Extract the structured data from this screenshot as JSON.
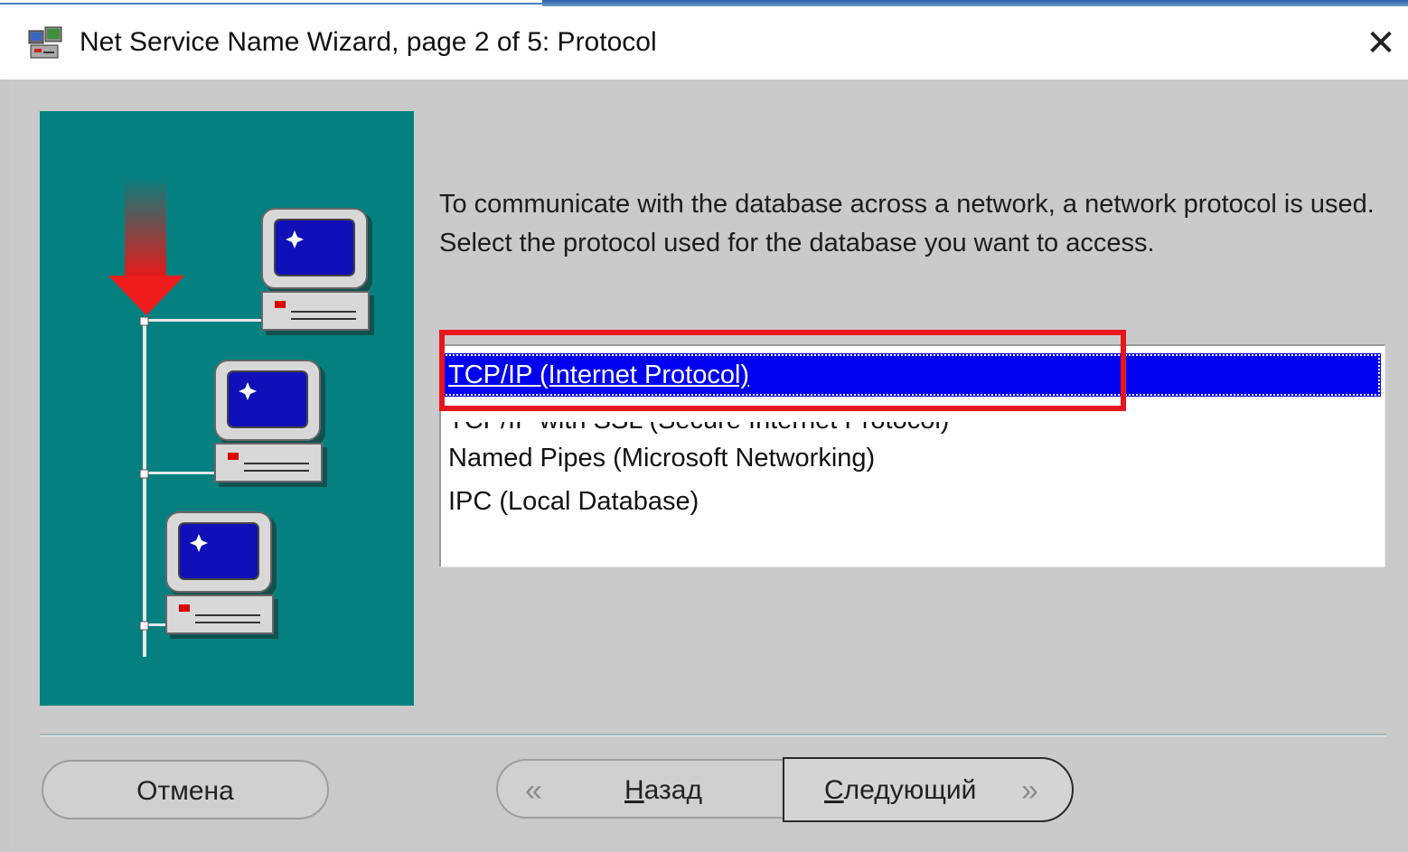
{
  "window": {
    "title": "Net Service Name Wizard, page 2 of 5: Protocol",
    "close_glyph": "✕"
  },
  "content": {
    "description": "To communicate with the database across a network, a network protocol is used.  Select the protocol used for the database you want to access."
  },
  "protocols": {
    "items": [
      {
        "label": "TCP/IP (Internet Protocol)",
        "selected": true
      },
      {
        "label": "TCP/IP with SSL (Secure Internet Protocol)",
        "selected": false
      },
      {
        "label": "Named Pipes (Microsoft Networking)",
        "selected": false
      },
      {
        "label": "IPC (Local Database)",
        "selected": false
      }
    ]
  },
  "buttons": {
    "cancel_label": "Отмена",
    "back_mnemonic": "Н",
    "back_rest": "азад",
    "next_mnemonic": "С",
    "next_rest": "ледующий",
    "back_icon": "«",
    "next_icon": "»"
  },
  "colors": {
    "illustration_bg": "#058080",
    "selection": "#0000f0",
    "annotation": "#e8151d",
    "dialog_bg": "#cacaca"
  },
  "icons": [
    "wizard-app-icon",
    "close-icon",
    "network-arrow-icon",
    "computer-icon",
    "back-arrow-icon",
    "next-arrow-icon"
  ]
}
